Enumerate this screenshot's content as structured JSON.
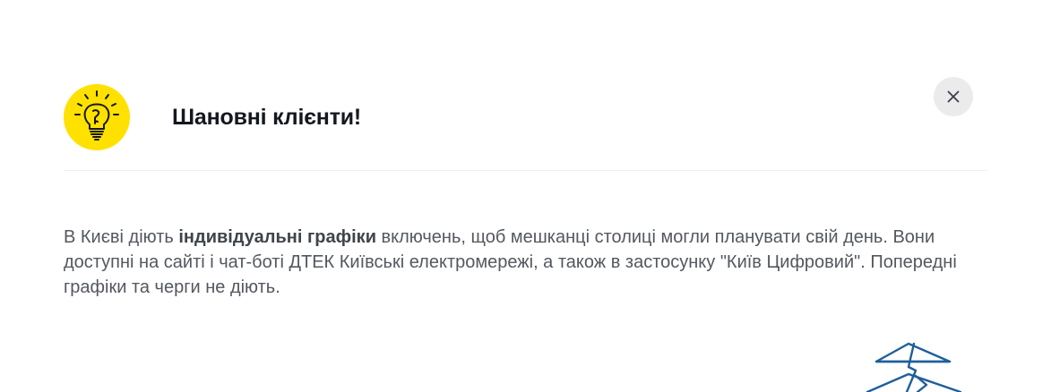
{
  "dialog": {
    "title": "Шановні клієнти!",
    "close_icon": "close-icon",
    "lightbulb_icon": "lightbulb-icon",
    "illustration_icon": "power-pylon-icon",
    "colors": {
      "accent": "#ffe100",
      "close_bg": "#ebebeb",
      "pylon": "#1f5f9a"
    }
  },
  "message": {
    "part1": "В Києві діють ",
    "bold": "індивідуальні графіки",
    "part2": " включень, щоб мешканці столиці могли планувати свій день. Вони доступні на сайті і чат-боті ДТЕК Київські електромережі, а також в застосунку \"Київ Цифровий\". Попередні графіки та черги не діють."
  }
}
